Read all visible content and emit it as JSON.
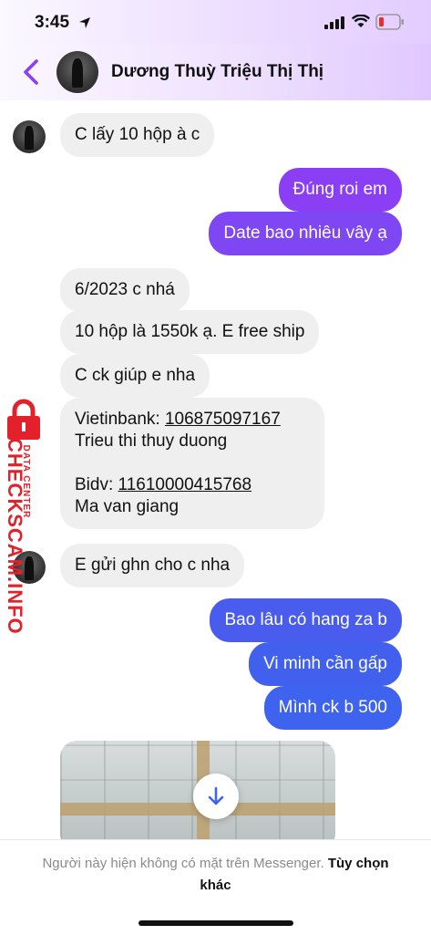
{
  "status_bar": {
    "time": "3:45"
  },
  "header": {
    "contact_name": "Dương Thuỳ Triệu Thị Thị"
  },
  "colors": {
    "outgoing_top": "#8a3ff5",
    "outgoing_bottom": "#3e63ee",
    "incoming": "#efefef",
    "watermark": "#e3212b"
  },
  "messages": [
    {
      "dir": "in",
      "text": "C lấy 10 hộp à c"
    },
    {
      "dir": "out",
      "text": "Đúng roi em"
    },
    {
      "dir": "out",
      "text": "Date bao nhiêu vây ạ"
    },
    {
      "dir": "in",
      "text": "6/2023 c nhá"
    },
    {
      "dir": "in",
      "text": "10 hộp là 1550k ạ. E free ship"
    },
    {
      "dir": "in",
      "text": "C ck giúp e nha"
    },
    {
      "dir": "in",
      "lines": [
        "Vietinbank: ",
        "Trieu thi thuy duong",
        "",
        "Bidv: ",
        "Ma van giang"
      ],
      "links": [
        "106875097167",
        "11610000415768"
      ]
    },
    {
      "dir": "in",
      "text": "E gửi ghn cho c nha"
    },
    {
      "dir": "out",
      "text": "Bao lâu có hang za b"
    },
    {
      "dir": "out",
      "text": "Vi minh cần gấp"
    },
    {
      "dir": "out",
      "text": "Mình ck b 500"
    }
  ],
  "footer": {
    "notice": "Người này hiện không có mặt trên Messenger.",
    "more_options": "Tùy chọn khác"
  },
  "watermark": {
    "brand": "CHECKSCAM.INFO",
    "sub": "DATA CENTER"
  }
}
